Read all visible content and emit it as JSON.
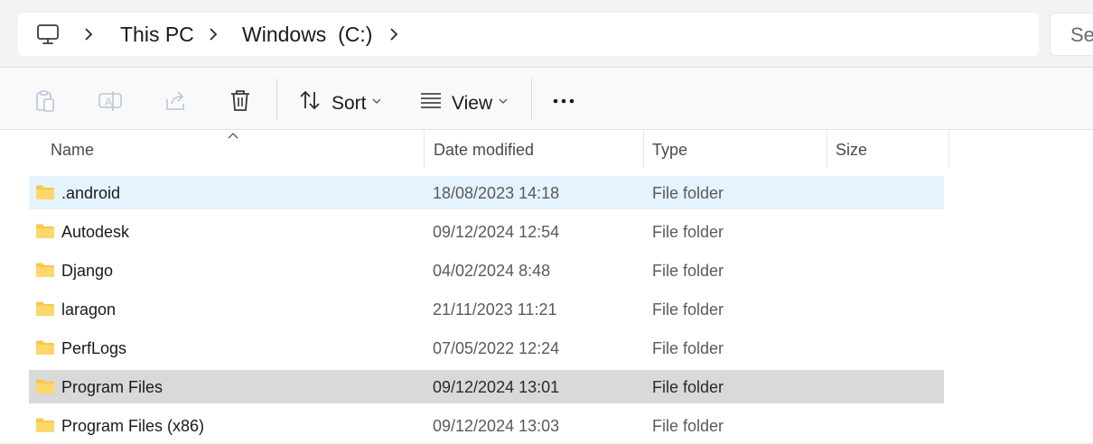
{
  "address": {
    "breadcrumbs": [
      "This PC",
      "Windows  (C:)"
    ],
    "search_placeholder": "Search"
  },
  "toolbar": {
    "sort_label": "Sort",
    "view_label": "View"
  },
  "columns": [
    "Name",
    "Date modified",
    "Type",
    "Size"
  ],
  "rows": [
    {
      "name": ".android",
      "date": "18/08/2023 14:18",
      "type": "File folder"
    },
    {
      "name": "Autodesk",
      "date": "09/12/2024 12:54",
      "type": "File folder"
    },
    {
      "name": "Django",
      "date": "04/02/2024 8:48",
      "type": "File folder"
    },
    {
      "name": "laragon",
      "date": "21/11/2023 11:21",
      "type": "File folder"
    },
    {
      "name": "PerfLogs",
      "date": "07/05/2022 12:24",
      "type": "File folder"
    },
    {
      "name": "Program Files",
      "date": "09/12/2024 13:01",
      "type": "File folder"
    },
    {
      "name": "Program Files (x86)",
      "date": "09/12/2024 13:03",
      "type": "File folder"
    }
  ],
  "icons": {
    "pc": "computer-icon",
    "folder": "folder-icon",
    "folder_color": "#f8c74a"
  }
}
